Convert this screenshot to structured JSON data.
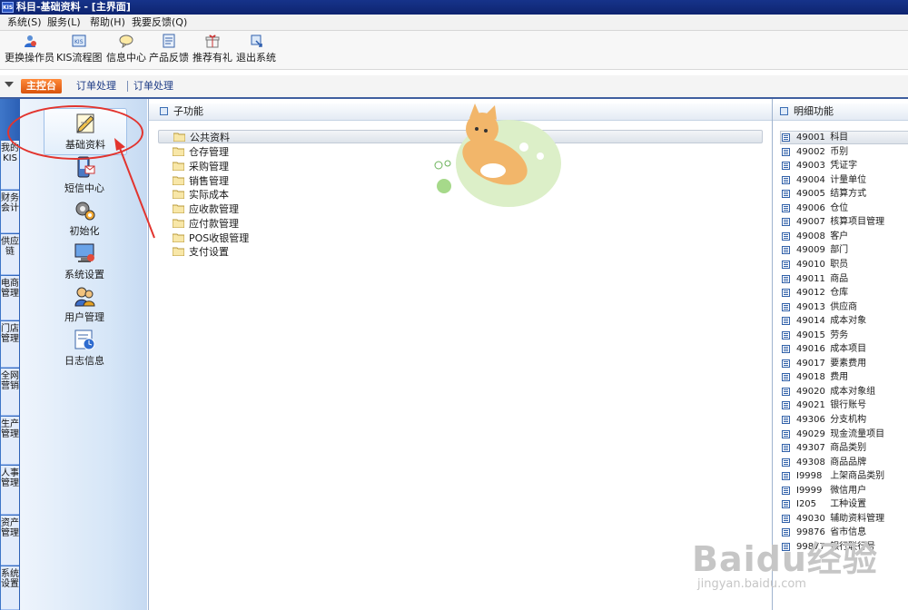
{
  "window": {
    "title": "科目-基础资料 - [主界面]",
    "app_icon_label": "KIS"
  },
  "menubar": [
    {
      "label": "系统(S)"
    },
    {
      "label": "服务(L)"
    },
    {
      "label": "帮助(H)"
    },
    {
      "label": "我要反馈(Q)"
    }
  ],
  "toolbar": [
    {
      "label": "更换操作员",
      "icon": "switch-user-icon"
    },
    {
      "label": "KIS流程图",
      "icon": "flowchart-icon"
    },
    {
      "label": "信息中心",
      "icon": "message-icon"
    },
    {
      "label": "产品反馈",
      "icon": "feedback-icon"
    },
    {
      "label": "推荐有礼",
      "icon": "gift-icon"
    },
    {
      "label": "退出系统",
      "icon": "exit-icon"
    }
  ],
  "tabs": {
    "active": "主控台",
    "items": [
      "订单处理",
      "订单处理"
    ]
  },
  "vertical_tabs": [
    "我的KIS",
    "财务会计",
    "供应链",
    "电商管理",
    "门店管理",
    "全网营销",
    "生产管理",
    "人事管理",
    "资产管理",
    "系统设置"
  ],
  "nav_buttons": [
    {
      "label": "基础资料",
      "icon": "basic-data-icon",
      "selected": true
    },
    {
      "label": "短信中心",
      "icon": "sms-icon",
      "selected": false
    },
    {
      "label": "初始化",
      "icon": "initialize-icon",
      "selected": false
    },
    {
      "label": "系统设置",
      "icon": "system-settings-icon",
      "selected": false
    },
    {
      "label": "用户管理",
      "icon": "user-management-icon",
      "selected": false
    },
    {
      "label": "日志信息",
      "icon": "log-icon",
      "selected": false
    }
  ],
  "subfunctions": {
    "header": "子功能",
    "items": [
      "公共资料",
      "仓存管理",
      "采购管理",
      "销售管理",
      "实际成本",
      "应收款管理",
      "应付款管理",
      "POS收银管理",
      "支付设置"
    ]
  },
  "details": {
    "header": "明细功能",
    "items": [
      {
        "code": "49001",
        "name": "科目"
      },
      {
        "code": "49002",
        "name": "币别"
      },
      {
        "code": "49003",
        "name": "凭证字"
      },
      {
        "code": "49004",
        "name": "计量单位"
      },
      {
        "code": "49005",
        "name": "结算方式"
      },
      {
        "code": "49006",
        "name": "仓位"
      },
      {
        "code": "49007",
        "name": "核算项目管理"
      },
      {
        "code": "49008",
        "name": "客户"
      },
      {
        "code": "49009",
        "name": "部门"
      },
      {
        "code": "49010",
        "name": "职员"
      },
      {
        "code": "49011",
        "name": "商品"
      },
      {
        "code": "49012",
        "name": "仓库"
      },
      {
        "code": "49013",
        "name": "供应商"
      },
      {
        "code": "49014",
        "name": "成本对象"
      },
      {
        "code": "49015",
        "name": "劳务"
      },
      {
        "code": "49016",
        "name": "成本项目"
      },
      {
        "code": "49017",
        "name": "要素费用"
      },
      {
        "code": "49018",
        "name": "费用"
      },
      {
        "code": "49020",
        "name": "成本对象组"
      },
      {
        "code": "49021",
        "name": "银行账号"
      },
      {
        "code": "49306",
        "name": "分支机构"
      },
      {
        "code": "49029",
        "name": "现金流量项目"
      },
      {
        "code": "49307",
        "name": "商品类别"
      },
      {
        "code": "49308",
        "name": "商品品牌"
      },
      {
        "code": "I9998",
        "name": "上架商品类别"
      },
      {
        "code": "I9999",
        "name": "微信用户"
      },
      {
        "code": "I205",
        "name": "工种设置"
      },
      {
        "code": "49030",
        "name": "辅助资料管理"
      },
      {
        "code": "99876",
        "name": "省市信息"
      },
      {
        "code": "99877",
        "name": "银行联行号"
      }
    ]
  },
  "watermark": {
    "brand": "Baidu经验",
    "url": "jingyan.baidu.com"
  },
  "colors": {
    "title_bar": "#0e2470",
    "active_tab": "#e8651e",
    "vertical_tab_bar": "#2b5fb5",
    "annotation": "#e2342e"
  }
}
